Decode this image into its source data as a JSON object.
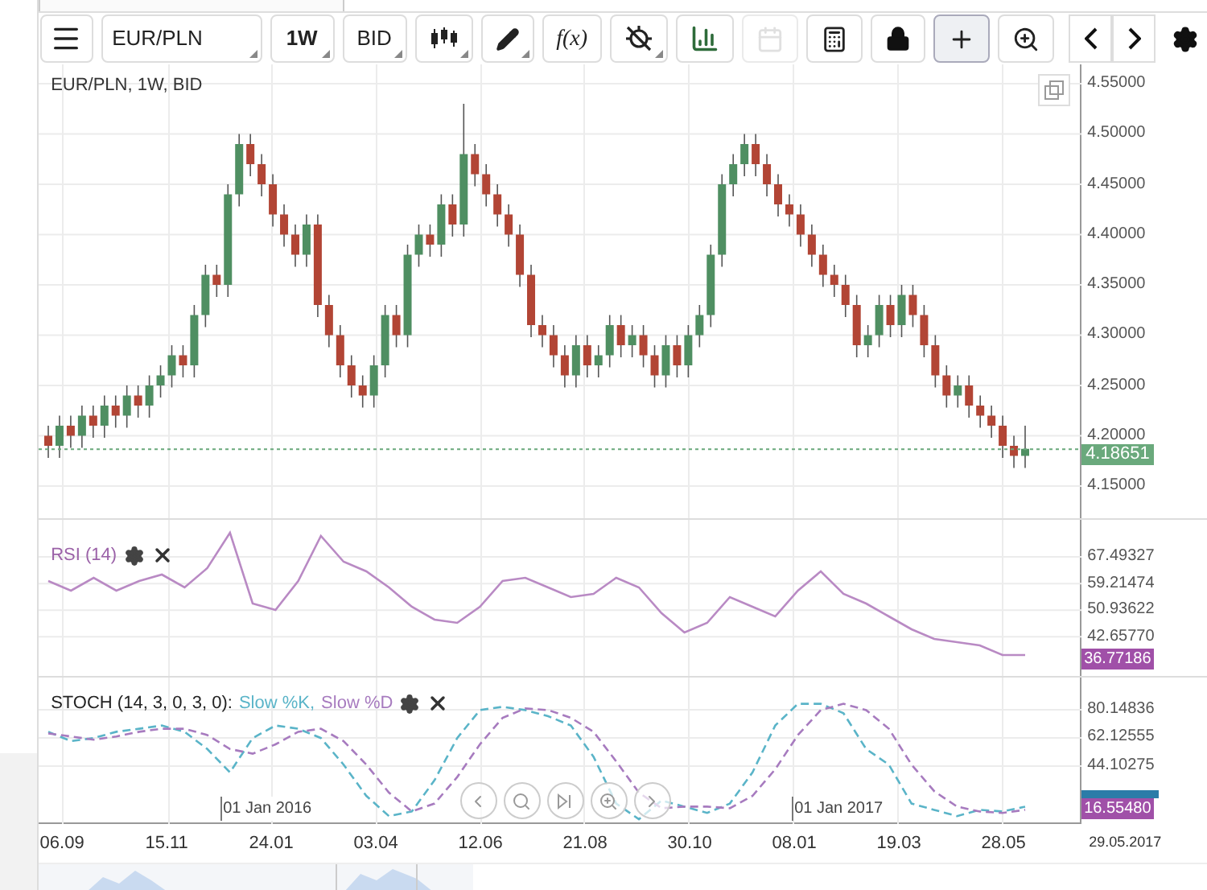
{
  "toolbar": {
    "symbol": "EUR/PLN",
    "interval": "1W",
    "price_type": "BID",
    "tools": [
      {
        "kind": "chart-type",
        "selected": false,
        "disabled": false,
        "has_menu": true
      },
      {
        "kind": "draw",
        "selected": false,
        "disabled": false,
        "has_menu": true
      },
      {
        "kind": "formula",
        "label": "f(x)",
        "selected": false,
        "disabled": false,
        "has_menu": false
      },
      {
        "kind": "target",
        "selected": false,
        "disabled": false,
        "has_menu": true
      },
      {
        "kind": "bars",
        "selected": false,
        "disabled": false,
        "has_menu": false
      },
      {
        "kind": "calendar",
        "selected": false,
        "disabled": true,
        "has_menu": false
      },
      {
        "kind": "calculator",
        "selected": false,
        "disabled": false,
        "has_menu": false
      },
      {
        "kind": "lock",
        "selected": false,
        "disabled": false,
        "has_menu": false
      },
      {
        "kind": "crosshair",
        "selected": true,
        "disabled": false,
        "has_menu": false
      },
      {
        "kind": "zoom",
        "selected": false,
        "disabled": false,
        "has_menu": false
      }
    ]
  },
  "price_panel": {
    "title": "EUR/PLN, 1W, BID",
    "chart_data": {
      "type": "candlestick",
      "grid": true,
      "ref_lines": [
        {
          "axis": "y",
          "value": 4.18651,
          "color": "#6aa97c",
          "label": "4.18651"
        }
      ],
      "ylim": [
        4.118,
        4.5692
      ],
      "yticks": [
        {
          "value": 4.55,
          "label": "4.55000"
        },
        {
          "value": 4.5,
          "label": "4.50000"
        },
        {
          "value": 4.45,
          "label": "4.45000"
        },
        {
          "value": 4.4,
          "label": "4.40000"
        },
        {
          "value": 4.35,
          "label": "4.35000"
        },
        {
          "value": 4.3,
          "label": "4.30000"
        },
        {
          "value": 4.25,
          "label": "4.25000"
        },
        {
          "value": 4.2,
          "label": "4.20000"
        },
        {
          "value": 4.15,
          "label": "4.15000"
        }
      ],
      "ohlc": [
        [
          4.2,
          4.21,
          4.178,
          4.19
        ],
        [
          4.19,
          4.22,
          4.178,
          4.21
        ],
        [
          4.21,
          4.22,
          4.188,
          4.2
        ],
        [
          4.2,
          4.23,
          4.188,
          4.22
        ],
        [
          4.22,
          4.23,
          4.198,
          4.21
        ],
        [
          4.21,
          4.24,
          4.198,
          4.23
        ],
        [
          4.23,
          4.24,
          4.208,
          4.22
        ],
        [
          4.22,
          4.25,
          4.208,
          4.24
        ],
        [
          4.24,
          4.25,
          4.218,
          4.23
        ],
        [
          4.23,
          4.26,
          4.218,
          4.25
        ],
        [
          4.25,
          4.27,
          4.238,
          4.26
        ],
        [
          4.26,
          4.29,
          4.248,
          4.28
        ],
        [
          4.28,
          4.29,
          4.258,
          4.27
        ],
        [
          4.27,
          4.33,
          4.258,
          4.32
        ],
        [
          4.32,
          4.37,
          4.308,
          4.36
        ],
        [
          4.36,
          4.37,
          4.338,
          4.35
        ],
        [
          4.35,
          4.45,
          4.338,
          4.44
        ],
        [
          4.44,
          4.5,
          4.428,
          4.49
        ],
        [
          4.49,
          4.5,
          4.458,
          4.47
        ],
        [
          4.47,
          4.48,
          4.438,
          4.45
        ],
        [
          4.45,
          4.46,
          4.408,
          4.42
        ],
        [
          4.42,
          4.43,
          4.388,
          4.4
        ],
        [
          4.4,
          4.41,
          4.368,
          4.38
        ],
        [
          4.38,
          4.42,
          4.368,
          4.41
        ],
        [
          4.41,
          4.42,
          4.318,
          4.33
        ],
        [
          4.33,
          4.34,
          4.288,
          4.3
        ],
        [
          4.3,
          4.31,
          4.258,
          4.27
        ],
        [
          4.27,
          4.28,
          4.238,
          4.25
        ],
        [
          4.25,
          4.26,
          4.228,
          4.24
        ],
        [
          4.24,
          4.28,
          4.228,
          4.27
        ],
        [
          4.27,
          4.33,
          4.258,
          4.32
        ],
        [
          4.32,
          4.33,
          4.288,
          4.3
        ],
        [
          4.3,
          4.39,
          4.288,
          4.38
        ],
        [
          4.38,
          4.41,
          4.368,
          4.4
        ],
        [
          4.4,
          4.41,
          4.378,
          4.39
        ],
        [
          4.39,
          4.44,
          4.378,
          4.43
        ],
        [
          4.43,
          4.44,
          4.398,
          4.41
        ],
        [
          4.41,
          4.53,
          4.398,
          4.48
        ],
        [
          4.48,
          4.49,
          4.448,
          4.46
        ],
        [
          4.46,
          4.47,
          4.428,
          4.44
        ],
        [
          4.44,
          4.45,
          4.408,
          4.42
        ],
        [
          4.42,
          4.43,
          4.388,
          4.4
        ],
        [
          4.4,
          4.41,
          4.348,
          4.36
        ],
        [
          4.36,
          4.37,
          4.298,
          4.31
        ],
        [
          4.31,
          4.32,
          4.288,
          4.3
        ],
        [
          4.3,
          4.31,
          4.268,
          4.28
        ],
        [
          4.28,
          4.29,
          4.248,
          4.26
        ],
        [
          4.26,
          4.3,
          4.248,
          4.29
        ],
        [
          4.29,
          4.3,
          4.258,
          4.27
        ],
        [
          4.27,
          4.29,
          4.258,
          4.28
        ],
        [
          4.28,
          4.32,
          4.268,
          4.31
        ],
        [
          4.31,
          4.32,
          4.278,
          4.29
        ],
        [
          4.29,
          4.31,
          4.278,
          4.3
        ],
        [
          4.3,
          4.31,
          4.268,
          4.28
        ],
        [
          4.28,
          4.29,
          4.248,
          4.26
        ],
        [
          4.26,
          4.3,
          4.248,
          4.29
        ],
        [
          4.29,
          4.3,
          4.258,
          4.27
        ],
        [
          4.27,
          4.31,
          4.258,
          4.3
        ],
        [
          4.3,
          4.33,
          4.288,
          4.32
        ],
        [
          4.32,
          4.39,
          4.308,
          4.38
        ],
        [
          4.38,
          4.46,
          4.368,
          4.45
        ],
        [
          4.45,
          4.48,
          4.438,
          4.47
        ],
        [
          4.47,
          4.5,
          4.458,
          4.49
        ],
        [
          4.49,
          4.5,
          4.458,
          4.47
        ],
        [
          4.47,
          4.48,
          4.438,
          4.45
        ],
        [
          4.45,
          4.46,
          4.418,
          4.43
        ],
        [
          4.43,
          4.44,
          4.408,
          4.42
        ],
        [
          4.42,
          4.43,
          4.388,
          4.4
        ],
        [
          4.4,
          4.41,
          4.368,
          4.38
        ],
        [
          4.38,
          4.39,
          4.348,
          4.36
        ],
        [
          4.36,
          4.37,
          4.338,
          4.35
        ],
        [
          4.35,
          4.36,
          4.318,
          4.33
        ],
        [
          4.33,
          4.34,
          4.278,
          4.29
        ],
        [
          4.29,
          4.31,
          4.278,
          4.3
        ],
        [
          4.3,
          4.34,
          4.288,
          4.33
        ],
        [
          4.33,
          4.34,
          4.298,
          4.31
        ],
        [
          4.31,
          4.35,
          4.298,
          4.34
        ],
        [
          4.34,
          4.35,
          4.308,
          4.32
        ],
        [
          4.32,
          4.33,
          4.278,
          4.29
        ],
        [
          4.29,
          4.3,
          4.248,
          4.26
        ],
        [
          4.26,
          4.27,
          4.228,
          4.24
        ],
        [
          4.24,
          4.26,
          4.228,
          4.25
        ],
        [
          4.25,
          4.26,
          4.218,
          4.23
        ],
        [
          4.23,
          4.24,
          4.208,
          4.22
        ],
        [
          4.22,
          4.23,
          4.198,
          4.21
        ],
        [
          4.21,
          4.22,
          4.178,
          4.19
        ],
        [
          4.19,
          4.2,
          4.168,
          4.18
        ],
        [
          4.18,
          4.21,
          4.168,
          4.187
        ]
      ]
    }
  },
  "rsi_panel": {
    "current_value": "36.77186",
    "chart_data": {
      "type": "line",
      "grid": true,
      "ylim": [
        30.5,
        79
      ],
      "yticks": [
        {
          "value": 67.49327,
          "label": "67.49327"
        },
        {
          "value": 59.21474,
          "label": "59.21474"
        },
        {
          "value": 50.93622,
          "label": "50.93622"
        },
        {
          "value": 42.6577,
          "label": "42.65770"
        }
      ],
      "series": [
        {
          "name": "RSI (14)",
          "color": "#b98ac4",
          "values": [
            60,
            57,
            61,
            57,
            60,
            62,
            58,
            64,
            75,
            53,
            51,
            60,
            74,
            66,
            63,
            58,
            52,
            48,
            47,
            52,
            60,
            61,
            58,
            55,
            56,
            61,
            58,
            50,
            44,
            47,
            55,
            52,
            49,
            57,
            63,
            56,
            53,
            49,
            45,
            42,
            41,
            40,
            37,
            37
          ]
        }
      ]
    }
  },
  "stoch_panel": {
    "title": "STOCH (14, 3, 0, 3, 0):",
    "current_value": "16.55480",
    "year_marks": [
      "01 Jan 2016",
      "01 Jan 2017"
    ],
    "chart_data": {
      "type": "line",
      "grid": true,
      "ylim": [
        6.9,
        100.8
      ],
      "yticks": [
        {
          "value": 80.14836,
          "label": "80.14836"
        },
        {
          "value": 62.12555,
          "label": "62.12555"
        },
        {
          "value": 44.10275,
          "label": "44.10275"
        }
      ],
      "series": [
        {
          "name": "Slow %K,",
          "color": "#5ab4c8",
          "line_style": "dashed",
          "values": [
            66,
            60,
            62,
            66,
            68,
            70,
            66,
            55,
            40,
            62,
            70,
            68,
            62,
            45,
            25,
            12,
            15,
            35,
            62,
            80,
            82,
            80,
            76,
            70,
            50,
            20,
            10,
            22,
            18,
            14,
            20,
            40,
            70,
            84,
            84,
            78,
            55,
            45,
            20,
            16,
            12,
            16,
            15,
            18
          ]
        },
        {
          "name": "Slow %D",
          "color": "#a77bbf",
          "line_style": "dashed",
          "values": [
            65,
            63,
            61,
            63,
            66,
            68,
            68,
            64,
            55,
            52,
            58,
            66,
            68,
            60,
            45,
            27,
            15,
            20,
            37,
            58,
            75,
            81,
            80,
            75,
            66,
            47,
            27,
            17,
            18,
            18,
            17,
            25,
            42,
            64,
            80,
            84,
            80,
            68,
            45,
            28,
            18,
            15,
            14,
            16
          ]
        }
      ]
    }
  },
  "date_axis": {
    "labels": [
      "06.09",
      "15.11",
      "24.01",
      "03.04",
      "12.06",
      "21.08",
      "30.10",
      "08.01",
      "19.03",
      "28.05"
    ],
    "last_date": "29.05.2017"
  }
}
